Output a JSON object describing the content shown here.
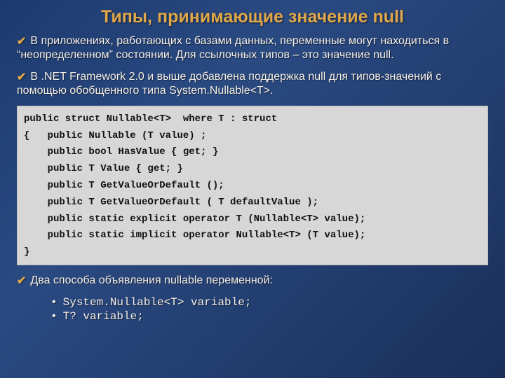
{
  "title": "Типы, принимающие значение null",
  "para1": "В приложениях, работающих с базами данных, переменные могут находиться в “неопределенном” состоянии. Для ссылочных типов – это значение null.",
  "para2": "В .NET Framework 2.0 и выше добавлена поддержка null для типов-значений с помощью обобщенного типа  System.Nullable<T>.",
  "code": {
    "l1": "public struct Nullable<T>  where T : struct",
    "l2": "{   public Nullable (T value) ;",
    "l3": "    public bool HasValue { get; }",
    "l4": "    public T Value { get; }",
    "l5": "    public T GetValueOrDefault ();",
    "l6": "    public T GetValueOrDefault ( T defaultValue );",
    "l7": "    public static explicit operator T (Nullable<T> value);",
    "l8": "    public static implicit operator Nullable<T> (T value);",
    "l9": "}"
  },
  "para3": "Два способа объявления nullable переменной:",
  "declare1": "System.Nullable<T> variable;",
  "declare2": "T? variable;"
}
